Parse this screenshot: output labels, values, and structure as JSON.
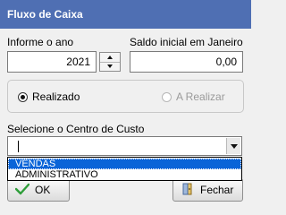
{
  "window": {
    "title": "Fluxo de Caixa"
  },
  "ano": {
    "label": "Informe o ano",
    "value": "2021"
  },
  "saldo": {
    "label": "Saldo inicial em Janeiro",
    "value": "0,00"
  },
  "tipo": {
    "options": [
      {
        "label": "Realizado",
        "selected": true,
        "enabled": true
      },
      {
        "label": "A Realizar",
        "selected": false,
        "enabled": false
      }
    ]
  },
  "centro_custo": {
    "label": "Selecione o Centro de Custo",
    "value": "",
    "options": [
      "VENDAS",
      "ADMINISTRATIVO"
    ],
    "highlighted": "VENDAS"
  },
  "buttons": {
    "ok": "OK",
    "fechar": "Fechar"
  }
}
